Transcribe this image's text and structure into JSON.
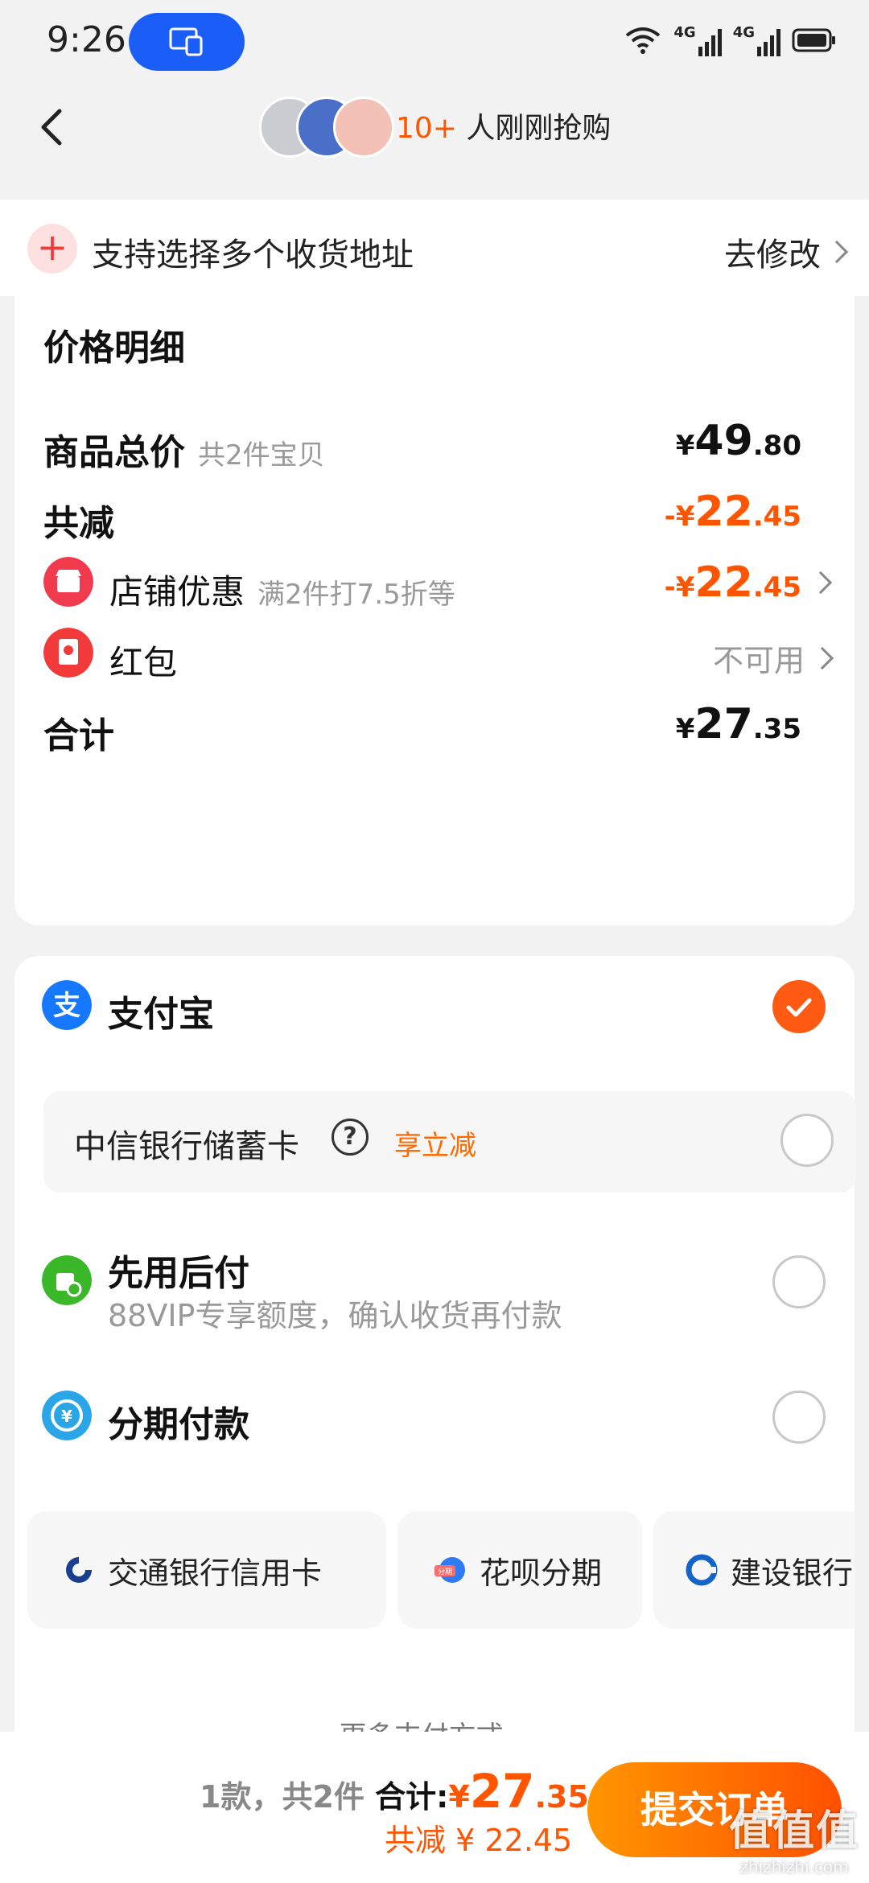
{
  "status_bar": {
    "time": "9:26",
    "network_1": "4G",
    "network_2": "4G"
  },
  "nav": {
    "buyers_count": "10+",
    "buyers_text": " 人刚刚抢购"
  },
  "address": {
    "label": "支持选择多个收货地址",
    "edit_label": "去修改"
  },
  "price_detail": {
    "title": "价格明细",
    "goods_total": {
      "label": "商品总价",
      "sub": "共2件宝贝",
      "currency": "¥",
      "int": "49",
      "dec": ".80"
    },
    "total_reduce": {
      "label": "共减",
      "prefix": "-¥",
      "int": "22",
      "dec": ".45"
    },
    "shop_discount": {
      "label": "店铺优惠",
      "sub": "满2件打7.5折等",
      "prefix": "-¥",
      "int": "22",
      "dec": ".45"
    },
    "red_packet": {
      "label": "红包",
      "status": "不可用"
    },
    "subtotal": {
      "label": "合计",
      "currency": "¥",
      "int": "27",
      "dec": ".35"
    }
  },
  "payment": {
    "alipay": {
      "label": "支付宝",
      "checked": true
    },
    "bank_card": {
      "label": "中信银行储蓄卡",
      "help": "?",
      "tag": "享立减"
    },
    "pay_later": {
      "label": "先用后付",
      "sub": "88VIP专享额度，确认收货再付款"
    },
    "installment": {
      "label": "分期付款",
      "options": [
        {
          "label": "交通银行信用卡",
          "icon": "bocom-icon"
        },
        {
          "label": "花呗分期",
          "icon": "huabei-icon",
          "badge": "分期"
        },
        {
          "label": "建设银行",
          "icon": "ccb-icon"
        }
      ]
    },
    "more_label": "更多支付方式"
  },
  "bottom_bar": {
    "count_text": "1款，共2件 ",
    "total_label": "合计:",
    "total_currency": "¥",
    "total_int": "27",
    "total_dec": ".35",
    "reduce_text": "共减 ¥ 22.45",
    "submit_label": "提交订单"
  },
  "watermark": {
    "big": "值值值",
    "small": "zhizhizhi.com"
  },
  "colors": {
    "accent": "#ff5500",
    "alipay_blue": "#1677ff",
    "radio_checked": "#ff5a14"
  }
}
